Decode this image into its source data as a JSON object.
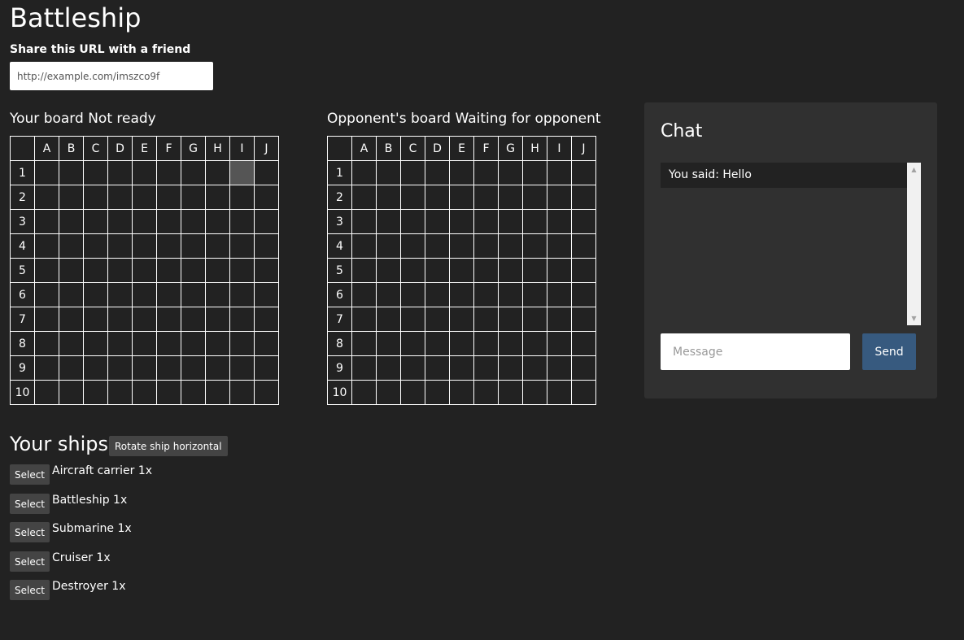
{
  "app": {
    "title": "Battleship",
    "share_label": "Share this URL with a friend",
    "share_url": "http://example.com/imszco9f"
  },
  "boards": {
    "columns": [
      "A",
      "B",
      "C",
      "D",
      "E",
      "F",
      "G",
      "H",
      "I",
      "J"
    ],
    "rows": [
      "1",
      "2",
      "3",
      "4",
      "5",
      "6",
      "7",
      "8",
      "9",
      "10"
    ],
    "own": {
      "label": "Your board",
      "status": "Not ready",
      "highlighted_cell": "I1"
    },
    "opponent": {
      "label": "Opponent's board",
      "status": "Waiting for opponent"
    }
  },
  "chat": {
    "title": "Chat",
    "messages": [
      "You said: Hello"
    ],
    "message_placeholder": "Message",
    "send_label": "Send"
  },
  "ships": {
    "heading": "Your ships",
    "rotate_label": "Rotate ship horizontal",
    "select_label": "Select",
    "list": [
      "Aircraft carrier 1x",
      "Battleship 1x",
      "Submarine 1x",
      "Cruiser 1x",
      "Destroyer 1x"
    ]
  },
  "colors": {
    "background": "#222222",
    "panel": "#303030",
    "accent": "#375a7f",
    "button": "#444444",
    "cell_highlight": "#555555"
  }
}
